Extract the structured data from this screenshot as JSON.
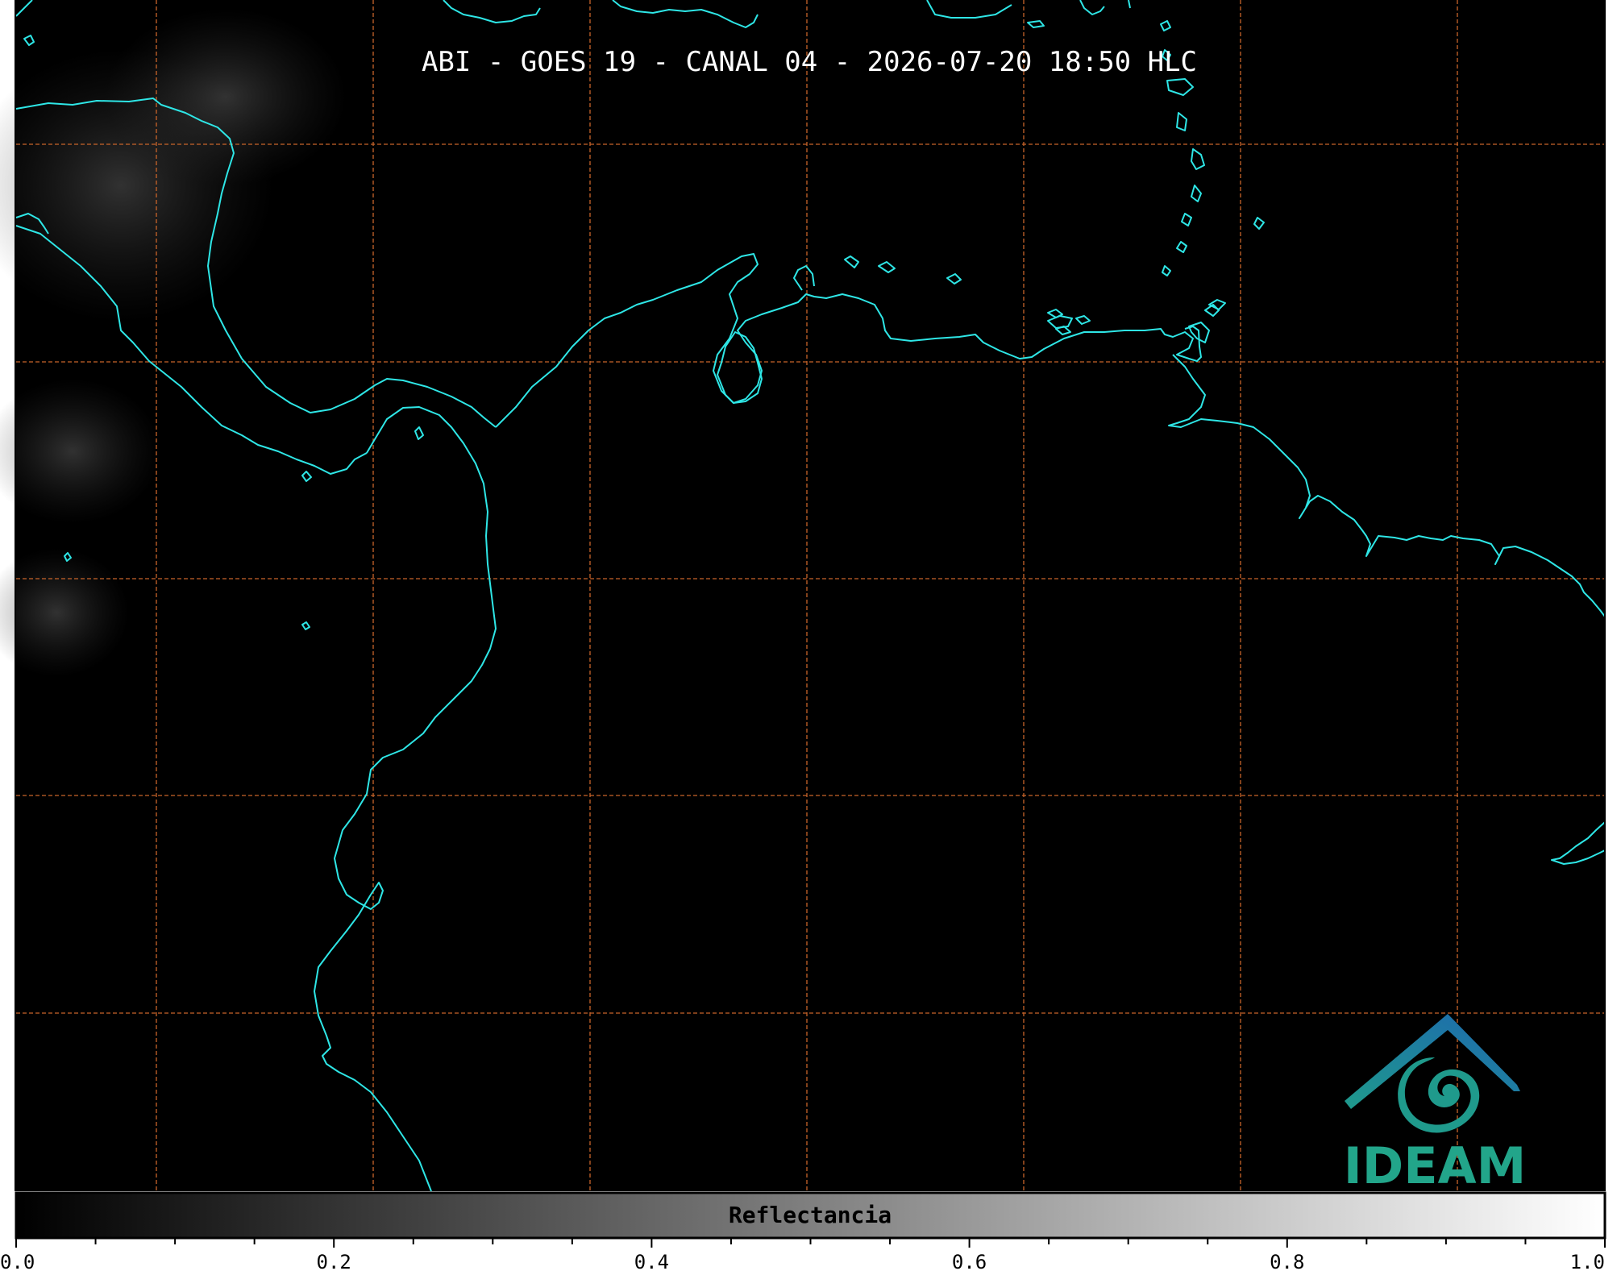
{
  "map": {
    "title": "ABI - GOES 19 - CANAL 04 - 2026-07-20 18:50 HLC",
    "colors": {
      "background": "#000000",
      "coastline": "#2ee6e6",
      "grid": "#c8642a",
      "logo_text": "#22a58a",
      "logo_blue": "#1d67b0",
      "logo_teal": "#1f9a8c"
    }
  },
  "colorbar": {
    "label": "Reflectancia",
    "min": 0.0,
    "max": 1.0,
    "tick_labels": [
      "0.0",
      "0.2",
      "0.4",
      "0.6",
      "0.8",
      "1.0"
    ],
    "minor_tick_count": 21,
    "colors": {
      "start": "#000000",
      "end": "#ffffff"
    }
  },
  "logo": {
    "text": "IDEAM"
  }
}
